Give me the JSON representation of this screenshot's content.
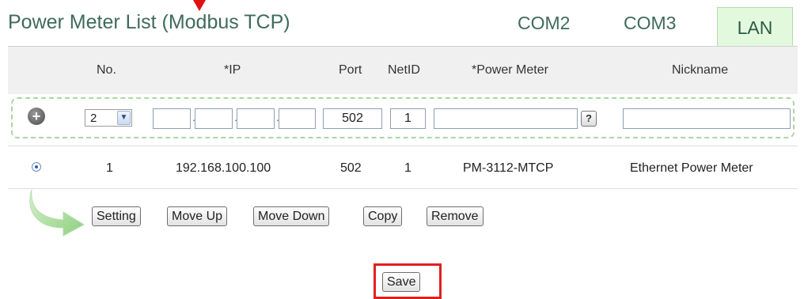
{
  "header": {
    "title": "Power Meter List (Modbus TCP)",
    "tabs": [
      {
        "label": "COM2"
      },
      {
        "label": "COM3"
      },
      {
        "label": "LAN"
      }
    ]
  },
  "columns": {
    "no": "No.",
    "ip": "*IP",
    "port": "Port",
    "netid": "NetID",
    "power_meter": "*Power Meter",
    "nickname": "Nickname"
  },
  "add_row": {
    "no_selected": "2",
    "ip_octets": [
      "",
      "",
      "",
      ""
    ],
    "port": "502",
    "netid": "1",
    "power_meter": "",
    "help_label": "?",
    "nickname": ""
  },
  "rows": [
    {
      "no": "1",
      "ip": "192.168.100.100",
      "port": "502",
      "netid": "1",
      "power_meter": "PM-3112-MTCP",
      "nickname": "Ethernet Power Meter"
    }
  ],
  "actions": {
    "setting": "Setting",
    "move_up": "Move Up",
    "move_down": "Move Down",
    "copy": "Copy",
    "remove": "Remove",
    "save": "Save"
  },
  "colors": {
    "title": "#3f6b5a",
    "active_tab_bg": "#e3f9de",
    "highlight_red": "#e02020",
    "dashed_border": "#a9d8a1"
  },
  "icons": [
    "plus-circle-icon",
    "chevron-down-icon",
    "radio-selected-icon",
    "curved-arrow-icon",
    "down-arrow-icon"
  ]
}
